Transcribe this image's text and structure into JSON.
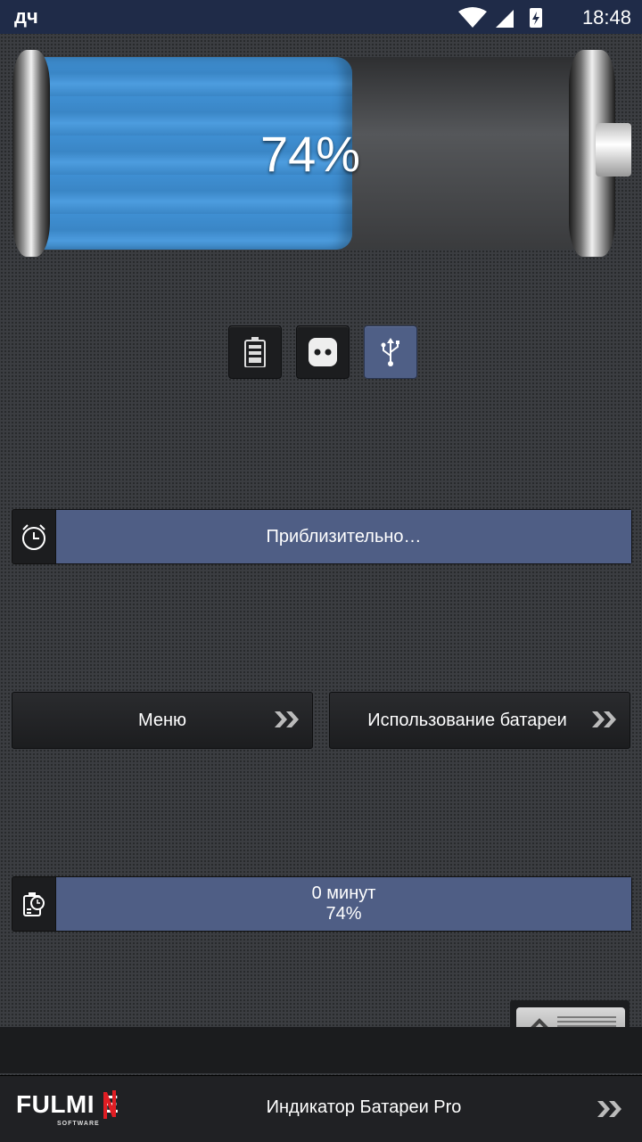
{
  "status_bar": {
    "left_indicator": "дч",
    "time": "18:48",
    "icons": [
      "wifi-icon",
      "signal-icon",
      "battery-charging-icon"
    ]
  },
  "battery": {
    "percent_label": "74%",
    "level": 0.74,
    "fill_color": "#3f8fd2"
  },
  "power_sources": [
    {
      "name": "battery-icon",
      "active": false
    },
    {
      "name": "ac-outlet-icon",
      "active": false
    },
    {
      "name": "usb-icon",
      "active": true
    }
  ],
  "estimate_bar": {
    "icon": "stopwatch-icon",
    "text": "Приблизительно…"
  },
  "buttons": {
    "menu": "Меню",
    "usage": "Использование батареи"
  },
  "charge_bar": {
    "icon": "charge-time-icon",
    "line1": "0 минут",
    "line2": "74%"
  },
  "footer": {
    "brand": "FULMI E",
    "brand_sub": "SOFTWARE",
    "title": "Индикатор Батареи Pro"
  },
  "colors": {
    "accent": "#4f5e85",
    "status_bar": "#1f2b48"
  }
}
